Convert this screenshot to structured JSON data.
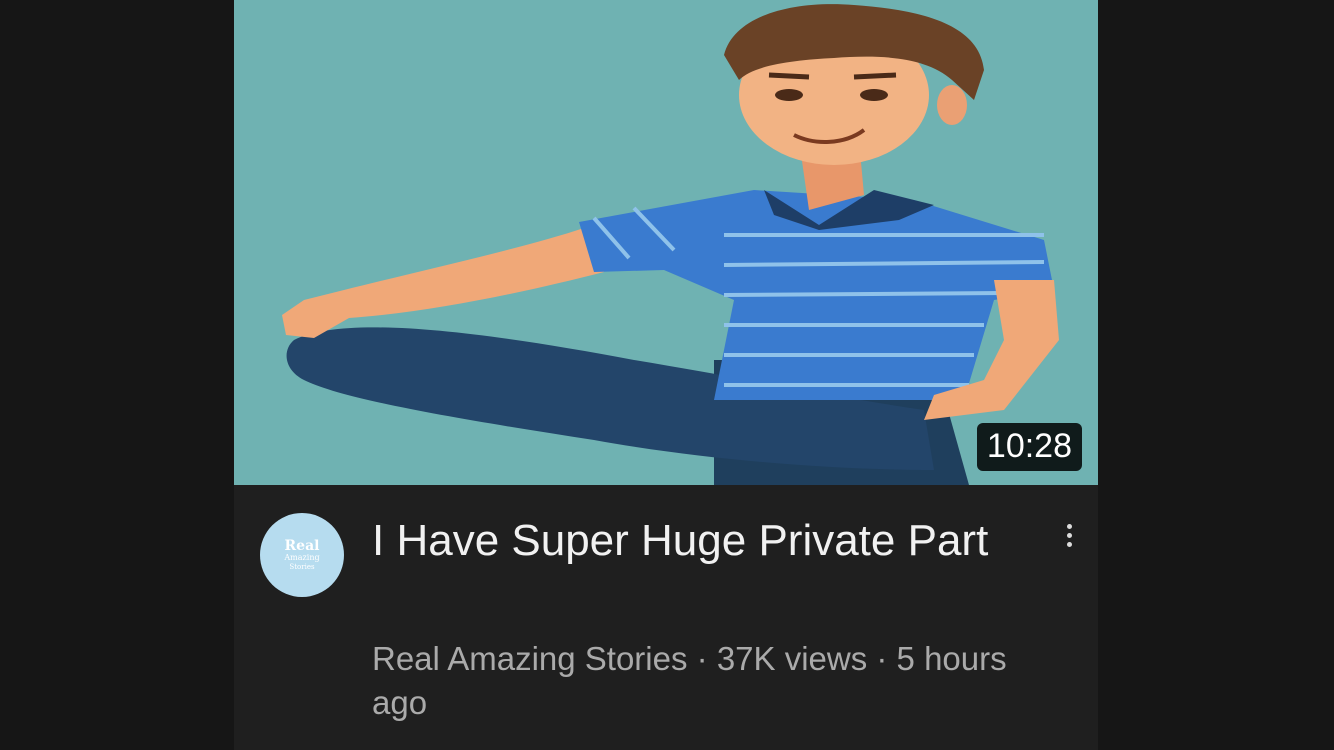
{
  "video": {
    "duration": "10:28",
    "title": "I Have Super Huge Private Part",
    "channel": "Real Amazing Stories",
    "views": "37K views",
    "age": "5 hours ago",
    "separator": " · "
  },
  "avatar": {
    "line1": "Real",
    "line2": "Amazing",
    "line3": "Stories"
  },
  "icons": {
    "menu": "more-vert-icon"
  },
  "colors": {
    "thumbnail_background": "#6fb2b2",
    "card_background": "#1f1f1f",
    "avatar_background": "#b6dcef"
  }
}
